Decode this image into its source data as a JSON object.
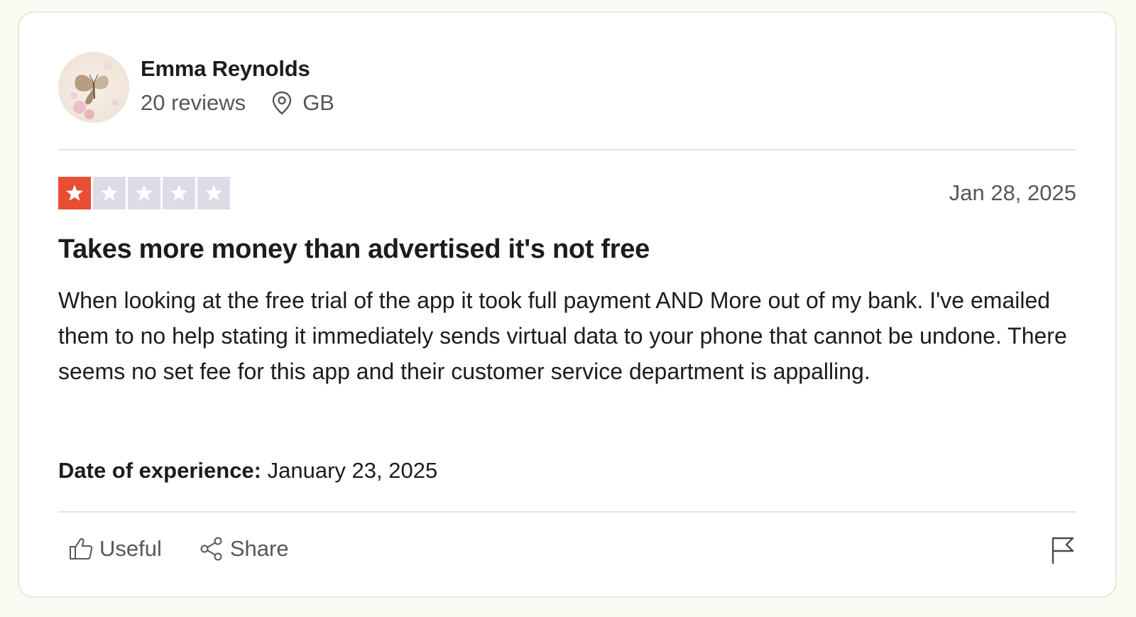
{
  "reviewer": {
    "name": "Emma Reynolds",
    "review_count": "20 reviews",
    "country": "GB",
    "avatar_icon": "butterfly-avatar",
    "location_icon": "map-pin-icon"
  },
  "review": {
    "rating": 1,
    "max_rating": 5,
    "rating_color": "#ea4d35",
    "empty_star_color": "#dcdce6",
    "date": "Jan 28, 2025",
    "title": "Takes more money than advertised it's not free",
    "body": "When looking at the free trial of the app it took full payment AND More out of my bank. I've emailed them to no help stating it immediately sends virtual data to your phone that cannot be undone. There seems no set fee for this app and their customer service department is appalling.",
    "experience_label": "Date of experience:",
    "experience_date": "January 23, 2025"
  },
  "actions": {
    "useful_label": "Useful",
    "useful_icon": "thumbs-up-icon",
    "share_label": "Share",
    "share_icon": "share-icon",
    "flag_icon": "flag-icon"
  }
}
